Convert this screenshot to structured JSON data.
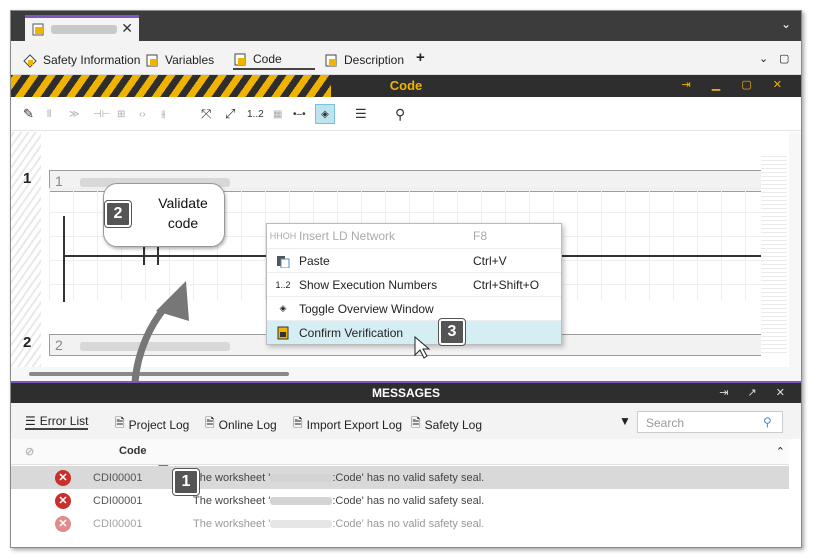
{
  "doc_tab": {
    "close": "✕"
  },
  "top_chevron": "⌄",
  "sub_tabs": [
    {
      "label": "Safety Information"
    },
    {
      "label": "Variables"
    },
    {
      "label": "Code"
    },
    {
      "label": "Description"
    }
  ],
  "add_tab": "+",
  "code_panel": {
    "title": "Code",
    "controls": "⇥ ▁ ▢ ✕"
  },
  "toolbar": {
    "zoom_numbers": "1..2"
  },
  "networks": [
    {
      "row": "1",
      "num": "1"
    },
    {
      "row": "2",
      "num": "2"
    }
  ],
  "context_menu": {
    "items": [
      {
        "label": "Insert LD Network",
        "shortcut": "F8",
        "disabled": true
      },
      {
        "label": "Paste",
        "shortcut": "Ctrl+V"
      },
      {
        "label": "Show Execution Numbers",
        "shortcut": "Ctrl+Shift+O"
      },
      {
        "label": "Toggle Overview Window",
        "shortcut": ""
      },
      {
        "label": "Confirm Verification",
        "shortcut": "",
        "highlighted": true
      }
    ],
    "exec_icon_text": "1..2",
    "insert_icon_text": "HHOH"
  },
  "callouts": {
    "bubble_text": "Validate code",
    "step1": "1",
    "step2": "2",
    "step3": "3"
  },
  "messages": {
    "title": "MESSAGES",
    "controls": "⇥ ↗ ✕",
    "tabs": [
      {
        "label": "Error List"
      },
      {
        "label": "Project Log"
      },
      {
        "label": "Online Log"
      },
      {
        "label": "Import Export Log"
      },
      {
        "label": "Safety Log"
      }
    ],
    "search_placeholder": "Search",
    "column_code": "Code",
    "rows": [
      {
        "code": "CDI00001",
        "pre": "The worksheet '",
        "post": ":Code' has no valid safety seal."
      },
      {
        "code": "CDI00001",
        "pre": "The worksheet '",
        "post": ":Code' has no valid safety seal."
      },
      {
        "code": "CDI00001",
        "pre": "The worksheet '",
        "post": ":Code' has no valid safety seal."
      }
    ]
  },
  "colors": {
    "accent": "#7e57c2",
    "hazard": "#f0b400",
    "error": "#c9302c",
    "highlight": "#d4eef3"
  }
}
